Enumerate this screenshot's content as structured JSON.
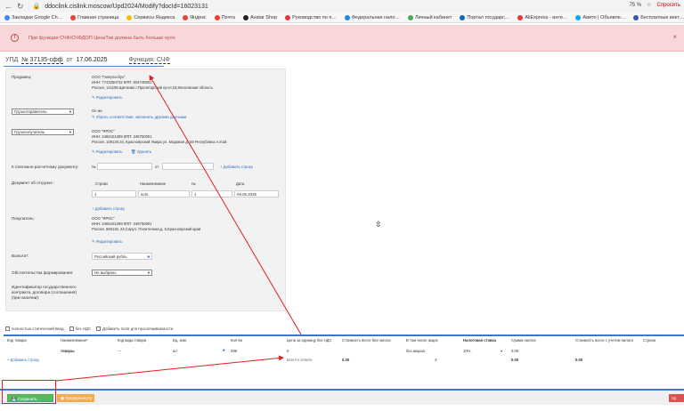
{
  "browser": {
    "url": "ddoclink.cislink.moscow/Upd2024/Modify?docId=16023131",
    "zoom": "75 %",
    "ask_label": "Спросить"
  },
  "bookmarks": [
    "Закладки Google Ch…",
    "Главная страница",
    "Сервисы Яндекса",
    "Яндекс",
    "Почта",
    "Avatar Shop",
    "Руководство по п…",
    "Федеральная нало…",
    "Личный кабинет",
    "Портал государс…",
    "AliExpress - инте…",
    "Авито | Объявле…",
    "Бесплатные вект…"
  ],
  "alert": {
    "text": "При функции СЧФ/СЧФДОП ЦенаТов должна быть больше нуля",
    "icon": "!",
    "close": "×"
  },
  "doc": {
    "type": "УПД",
    "num_label": "№ 37135-сфф",
    "from": "от",
    "date": "17.06.2025",
    "func_label": "Функция: СЧФ"
  },
  "seller": {
    "label": "Продавец:",
    "name": "ООО \"Гипергосбух\"",
    "inn": "ИНН: 7743250732 КПП: 504745001",
    "address": "Россия, 141195 Щёлково г.Пролетарский пр-кт,18,Московская область",
    "edit": "Редактировать"
  },
  "shipper": {
    "select": "Грузоотправитель",
    "value": "Он же",
    "links": "Убрать соответствие, заполнить другими данными"
  },
  "consignee": {
    "select": "Грузополучатель",
    "name": "ООО \"ЯРОС\"",
    "inn": "ИНН: 2466101289 КПП: 246750001",
    "address": "Россия, 109120,34, Красноярский Умира ул. Мадовая д. 59 Республика Алтай",
    "edit": "Редактировать",
    "delete": "Удалить"
  },
  "payment": {
    "label": "К платежно-расчетному документу:",
    "prefix": "№",
    "from": "от",
    "add": "Добавить строку"
  },
  "shipment": {
    "label": "Документ об отгрузке :",
    "cols": [
      "Строки",
      "Наименование",
      "№",
      "Дата"
    ],
    "row": {
      "line": "1",
      "name": "acts",
      "num": "1",
      "date": "09.06.2025"
    },
    "add": "Добавить строку"
  },
  "buyer": {
    "label": "Покупатель:",
    "name": "ООО \"ЯРОС\"",
    "inn": "ИНН: 2466101289 КПП: 246750001",
    "address": "Россия, 660118, 24,Сарул. Политичная,д. 5,Красноярский край",
    "edit": "Редактировать"
  },
  "currency": {
    "label": "Валюта*:",
    "value": "Российский рубль"
  },
  "basis": {
    "label": "Обстоятельства формирования:",
    "value": "Не выбрано"
  },
  "gov": {
    "label": "Идентификатор государственного контракта, договора (соглашения) (при наличии):"
  },
  "options": [
    "полностью статический ввод",
    "без НДС",
    "Добавить поля для прослеживаемости"
  ],
  "table": {
    "headers": [
      "Код товара",
      "Наименование*",
      "Код вида товара",
      "Ед. изм.",
      "Кол-во",
      "Цена за единицу без НДС",
      "Стоимость всего без налога",
      "В том числе акциз",
      "Налоговая ставка",
      "Сумма налога",
      "Стоимость всего с учетом налога",
      "Страна"
    ],
    "row": {
      "name": "товары",
      "kind": "---",
      "unit": "шт",
      "qty": "298",
      "price": "0",
      "excise": "без акциза",
      "rate": "10%",
      "tax": "0.00"
    },
    "sub": {
      "add": "Добавить строку",
      "hint": "Всего к оплате",
      "total": "0.00",
      "excise_total": "X",
      "tax_total": "0.00",
      "grand": "0.00"
    }
  },
  "buttons": {
    "save": "Сохранить документ",
    "preview": "Предпросмотр",
    "right": "Уд"
  }
}
